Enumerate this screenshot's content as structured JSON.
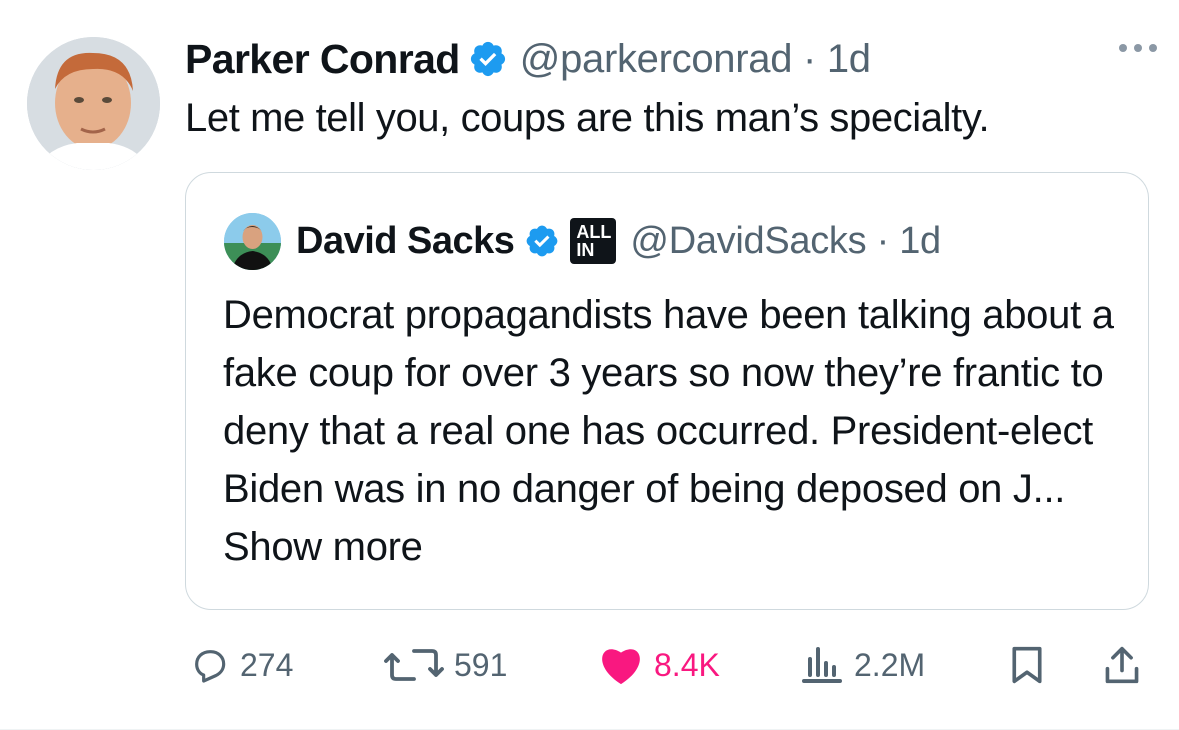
{
  "tweet": {
    "author_name": "Parker Conrad",
    "author_handle": "@parkerconrad",
    "time": "1d",
    "text": "Let me tell you, coups are this man’s specialty."
  },
  "quoted": {
    "author_name": "David Sacks",
    "badge_text_1": "ALL",
    "badge_text_2": "IN",
    "author_handle": "@DavidSacks",
    "time": "1d",
    "text": "Democrat propagandists have been talking about a fake coup for over 3 years so now they’re frantic to deny that a real one has occurred. President-elect Biden was in no danger of being deposed on J...",
    "show_more": "Show more"
  },
  "actions": {
    "replies": "274",
    "reposts": "591",
    "likes": "8.4K",
    "views": "2.2M"
  },
  "colors": {
    "verified": "#1d9bf0",
    "like": "#f91880",
    "secondary_text": "#536471"
  }
}
